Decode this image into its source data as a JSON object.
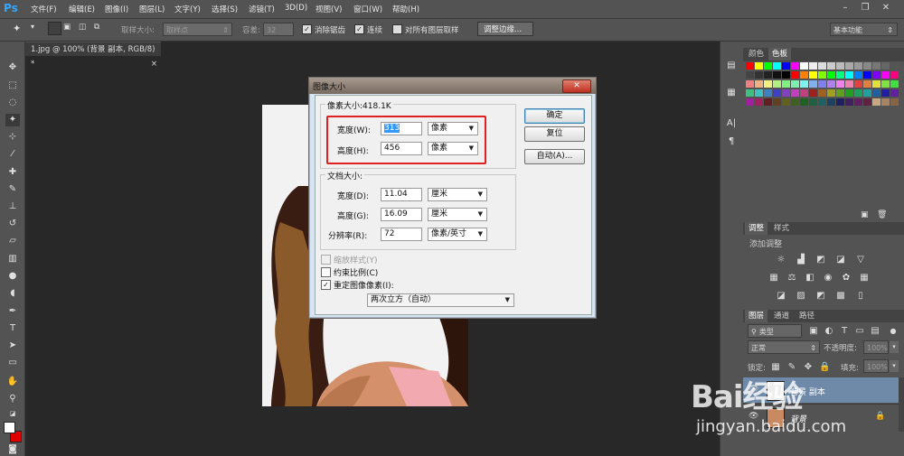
{
  "app": {
    "logo": "Ps"
  },
  "menu": [
    "文件(F)",
    "编辑(E)",
    "图像(I)",
    "图层(L)",
    "文字(Y)",
    "选择(S)",
    "滤镜(T)",
    "3D(D)",
    "视图(V)",
    "窗口(W)",
    "帮助(H)"
  ],
  "options": {
    "sample_size_label": "取样大小:",
    "sample_size_value": "取样点",
    "tolerance_label": "容差:",
    "tolerance_value": "32",
    "antialias_label": "消除锯齿",
    "contiguous_label": "连续",
    "all_layers_label": "对所有图层取样",
    "refine_edge_button": "调整边缘...",
    "workspace": "基本功能"
  },
  "document_tab": "1.jpg @ 100% (背景 副本, RGB/8) *",
  "dialog": {
    "title": "图像大小",
    "pixel_dimensions": "像素大小:418.1K",
    "width_label": "宽度(W):",
    "width_value": "313",
    "width_unit": "像素",
    "height_label": "高度(H):",
    "height_value": "456",
    "height_unit": "像素",
    "document_size": "文档大小:",
    "doc_width_label": "宽度(D):",
    "doc_width_value": "11.04",
    "doc_width_unit": "厘米",
    "doc_height_label": "高度(G):",
    "doc_height_value": "16.09",
    "doc_height_unit": "厘米",
    "resolution_label": "分辨率(R):",
    "resolution_value": "72",
    "resolution_unit": "像素/英寸",
    "scale_styles": "缩放样式(Y)",
    "constrain": "约束比例(C)",
    "resample": "重定图像像素(I):",
    "resample_method": "两次立方（自动）",
    "ok_button": "确定",
    "reset_button": "复位",
    "auto_button": "自动(A)..."
  },
  "panels": {
    "color_tab": "颜色",
    "swatches_tab": "色板",
    "adjust_tab": "调整",
    "styles_tab": "样式",
    "add_adjustment": "添加调整",
    "layers_tab": "图层",
    "channels_tab": "通道",
    "paths_tab": "路径",
    "kind_label": "类型",
    "blend_mode": "正常",
    "opacity_label": "不透明度:",
    "opacity_value": "100%",
    "lock_label": "锁定:",
    "fill_label": "填充:",
    "fill_value": "100%",
    "layers": [
      {
        "name": "背景 副本"
      },
      {
        "name": "背景"
      }
    ]
  },
  "watermark": {
    "brand": "Bai经验",
    "url": "jingyan.baidu.com"
  },
  "colors": {
    "accent_red": "#e02020",
    "ps_blue": "#31a8ff"
  }
}
